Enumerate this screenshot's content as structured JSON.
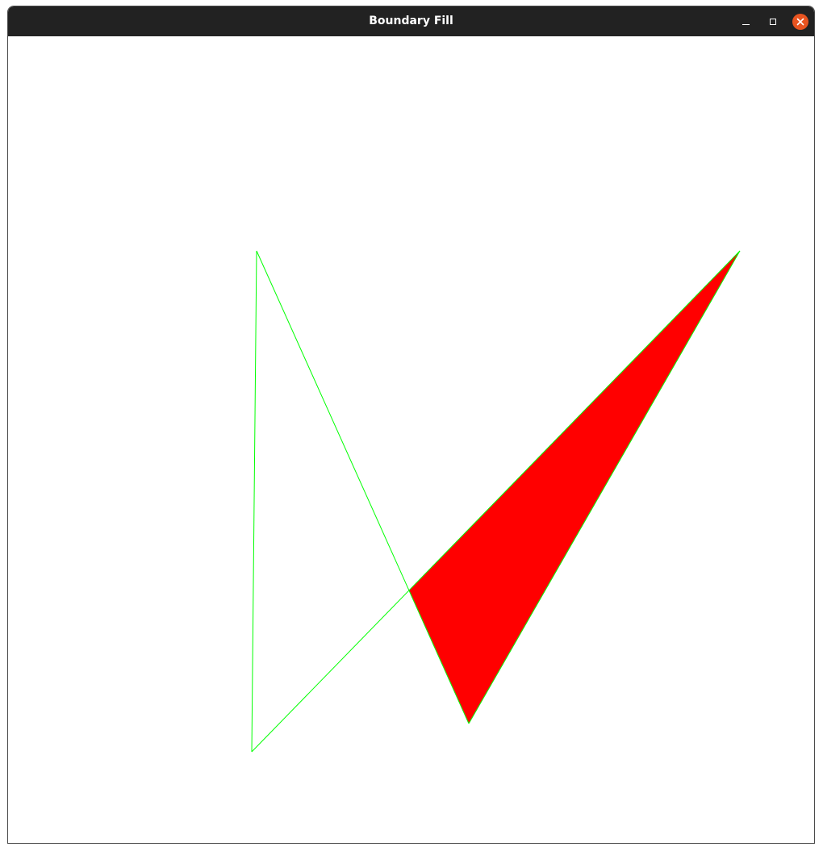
{
  "window": {
    "title": "Boundary Fill"
  },
  "controls": {
    "minimize_icon": "minimize-icon",
    "maximize_icon": "maximize-icon",
    "close_icon": "close-icon"
  },
  "colors": {
    "titlebar": "#222222",
    "title_text": "#ffffff",
    "close_button": "#e95420",
    "boundary": "#00ff00",
    "fill": "#ff0000",
    "canvas_bg": "#ffffff"
  }
}
